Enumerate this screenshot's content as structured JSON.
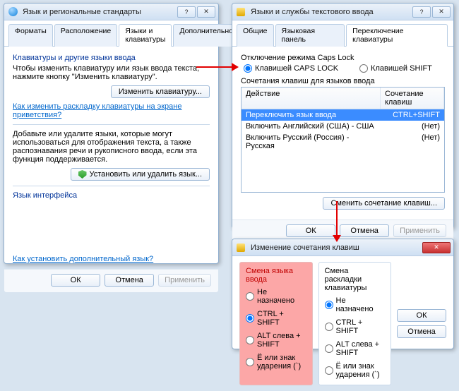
{
  "win1": {
    "title": "Язык и региональные стандарты",
    "tabs": [
      "Форматы",
      "Расположение",
      "Языки и клавиатуры",
      "Дополнительно"
    ],
    "activeTab": 2,
    "section1_heading": "Клавиатуры и другие языки ввода",
    "section1_text": "Чтобы изменить клавиатуру или язык ввода текста, нажмите кнопку \"Изменить клавиатуру\".",
    "btn_change_kb": "Изменить клавиатуру...",
    "link1": "Как изменить раскладку клавиатуры на экране приветствия?",
    "section2_text": "Добавьте или удалите языки, которые могут использоваться для отображения текста, а также распознавания речи и рукописного ввода, если эта функция поддерживается.",
    "btn_install": "Установить или удалить язык...",
    "section3_heading": "Язык интерфейса",
    "link2": "Как установить дополнительный язык?",
    "ok": "ОК",
    "cancel": "Отмена",
    "apply": "Применить"
  },
  "win2": {
    "title": "Языки и службы текстового ввода",
    "tabs": [
      "Общие",
      "Языковая панель",
      "Переключение клавиатуры"
    ],
    "activeTab": 2,
    "caps_heading": "Отключение режима Caps Lock",
    "caps_opt1": "Клавишей CAPS LOCK",
    "caps_opt2": "Клавишей SHIFT",
    "combo_heading": "Сочетания клавиш для языков ввода",
    "col_action": "Действие",
    "col_shortcut": "Сочетание клавиш",
    "rows": [
      {
        "action": "Переключить язык ввода",
        "shortcut": "CTRL+SHIFT",
        "sel": true
      },
      {
        "action": "Включить Английский (США) - США",
        "shortcut": "(Нет)",
        "sel": false
      },
      {
        "action": "Включить Русский (Россия) - Русская",
        "shortcut": "(Нет)",
        "sel": false
      }
    ],
    "btn_change": "Сменить сочетание клавиш...",
    "ok": "ОК",
    "cancel": "Отмена",
    "apply": "Применить"
  },
  "win3": {
    "title": "Изменение сочетания клавиш",
    "left_head": "Смена языка ввода",
    "right_head": "Смена раскладки клавиатуры",
    "opts": [
      "Не назначено",
      "CTRL + SHIFT",
      "ALT слева + SHIFT",
      "Ё или знак ударения (`)"
    ],
    "left_selected": 1,
    "right_selected": 0,
    "ok": "ОК",
    "cancel": "Отмена"
  }
}
